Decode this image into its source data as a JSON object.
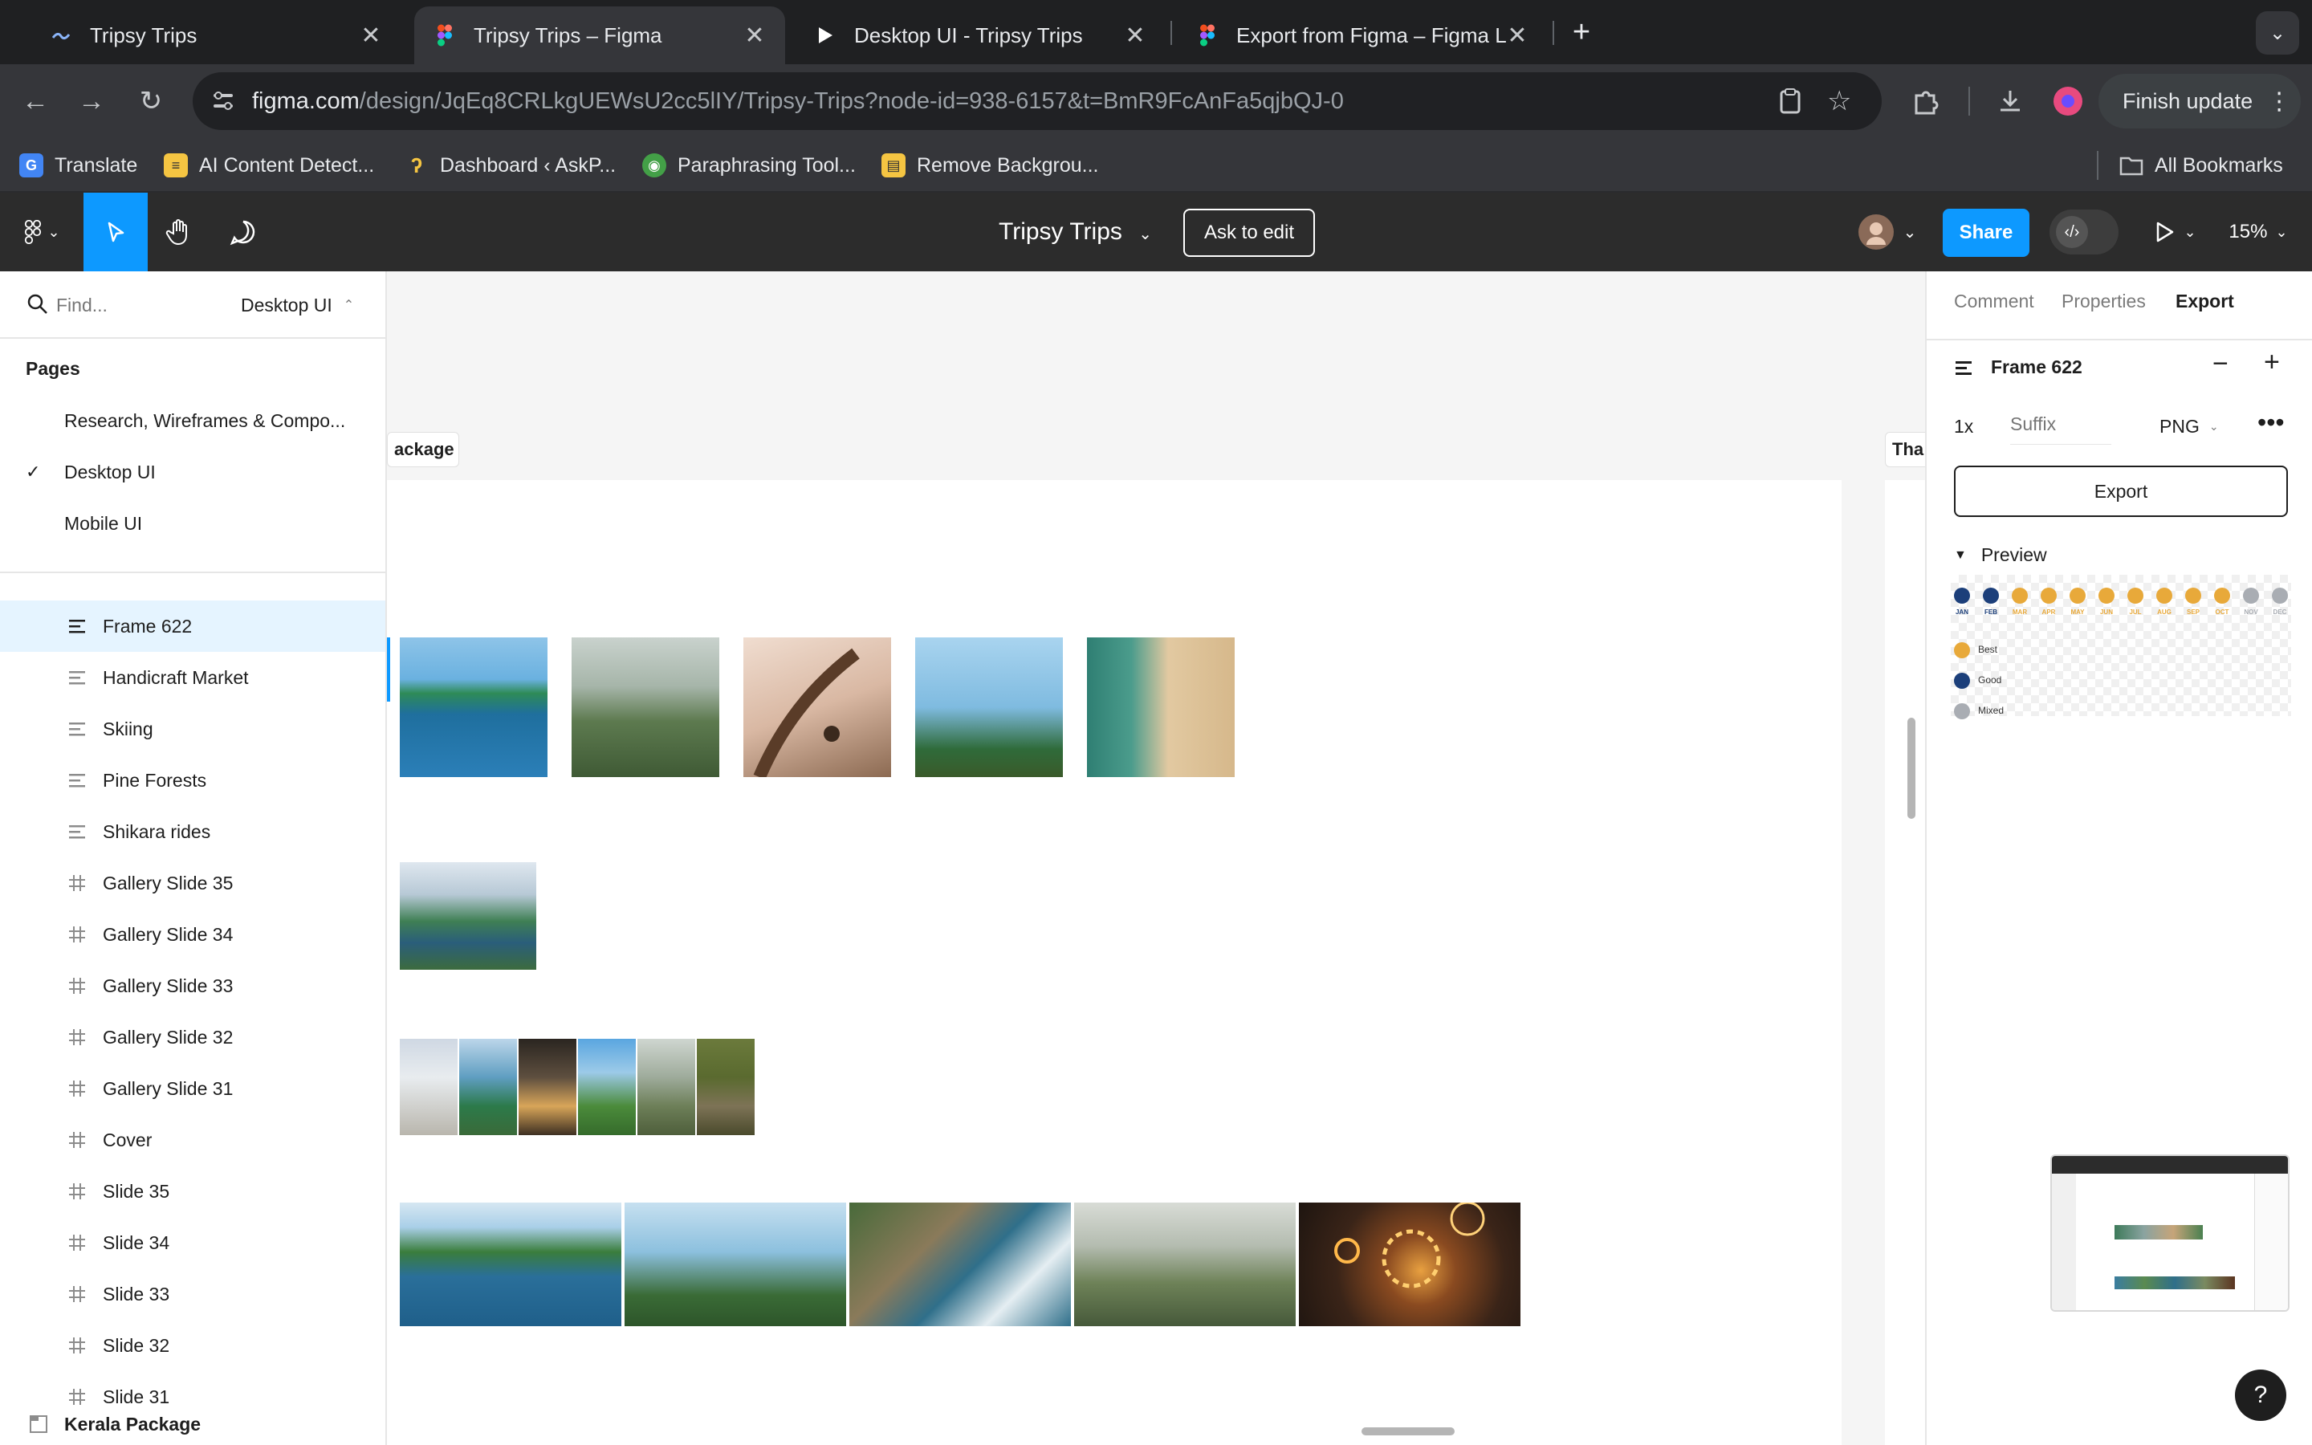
{
  "browser": {
    "tabs": [
      {
        "title": "Tripsy Trips",
        "active": false
      },
      {
        "title": "Tripsy Trips – Figma",
        "active": true
      },
      {
        "title": "Desktop UI - Tripsy Trips",
        "active": false
      },
      {
        "title": "Export from Figma – Figma Le",
        "active": false
      }
    ],
    "url_host": "figma.com",
    "url_path": "/design/JqEq8CRLkgUEWsU2cc5lIY/Tripsy-Trips?node-id=938-6157&t=BmR9FcAnFa5qjbQJ-0",
    "finish_update": "Finish update",
    "bookmarks": [
      "Translate",
      "AI Content Detect...",
      "Dashboard ‹ AskP...",
      "Paraphrasing Tool...",
      "Remove Backgrou..."
    ],
    "all_bookmarks": "All Bookmarks"
  },
  "figma": {
    "doc_title": "Tripsy Trips",
    "ask_to_edit": "Ask to edit",
    "share": "Share",
    "zoom": "15%"
  },
  "left_panel": {
    "find_placeholder": "Find...",
    "current_page": "Desktop UI",
    "pages_heading": "Pages",
    "pages": [
      "Research, Wireframes & Compo...",
      "Desktop UI",
      "Mobile UI"
    ],
    "layers": [
      {
        "name": "Frame 622",
        "type": "auto",
        "selected": true
      },
      {
        "name": "Handicraft Market",
        "type": "auto"
      },
      {
        "name": "Skiing",
        "type": "auto"
      },
      {
        "name": "Pine Forests",
        "type": "auto"
      },
      {
        "name": "Shikara rides",
        "type": "auto"
      },
      {
        "name": "Gallery Slide 35",
        "type": "frame"
      },
      {
        "name": "Gallery Slide 34",
        "type": "frame"
      },
      {
        "name": "Gallery Slide 33",
        "type": "frame"
      },
      {
        "name": "Gallery Slide 32",
        "type": "frame"
      },
      {
        "name": "Gallery Slide 31",
        "type": "frame"
      },
      {
        "name": "Cover",
        "type": "frame"
      },
      {
        "name": "Slide 35",
        "type": "frame"
      },
      {
        "name": "Slide 34",
        "type": "frame"
      },
      {
        "name": "Slide 33",
        "type": "frame"
      },
      {
        "name": "Slide 32",
        "type": "frame"
      },
      {
        "name": "Slide 31",
        "type": "frame"
      }
    ],
    "section": "Kerala Package"
  },
  "canvas": {
    "frame_label_left": "ackage",
    "frame_label_right": "Tha"
  },
  "right_panel": {
    "tabs": [
      "Comment",
      "Properties",
      "Export"
    ],
    "layer_name": "Frame 622",
    "scale": "1x",
    "suffix_placeholder": "Suffix",
    "format": "PNG",
    "export_button": "Export",
    "preview_label": "Preview",
    "months": [
      "JAN",
      "FEB",
      "MAR",
      "APR",
      "MAY",
      "JUN",
      "JUL",
      "AUG",
      "SEP",
      "OCT",
      "NOV",
      "DEC"
    ],
    "legend": [
      "Best",
      "Good",
      "Mixed"
    ],
    "colors": {
      "best": "#e8a93a",
      "good": "#1c3f7a",
      "mixed": "#a9adb3"
    }
  },
  "help": "?"
}
